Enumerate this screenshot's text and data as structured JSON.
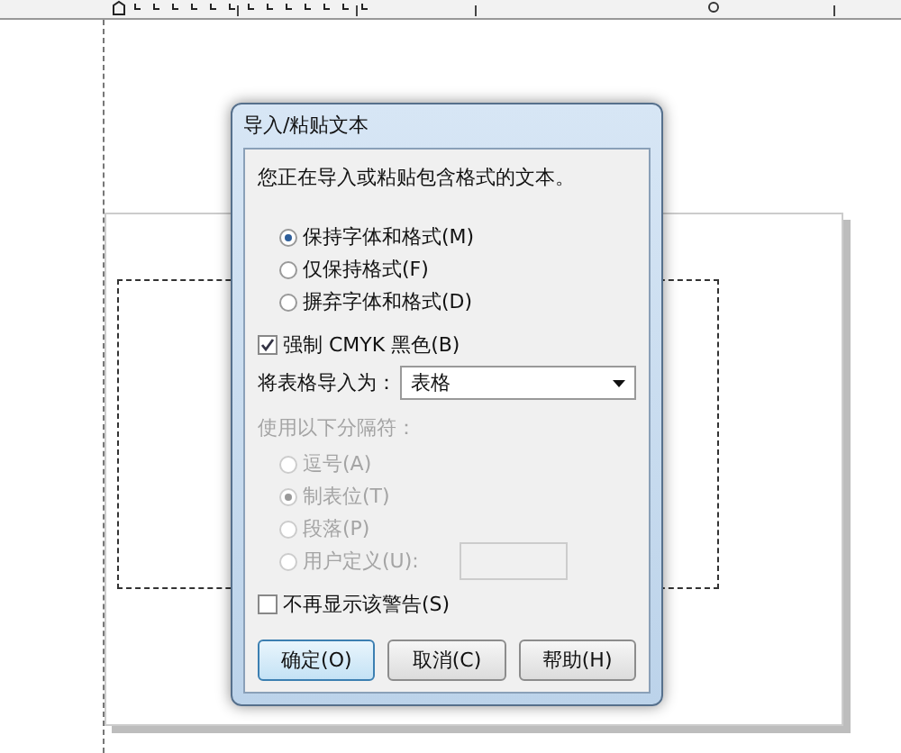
{
  "dialog": {
    "title": "导入/粘贴文本",
    "message": "您正在导入或粘贴包含格式的文本。",
    "format_options": [
      {
        "label": "保持字体和格式(M)",
        "selected": true
      },
      {
        "label": "仅保持格式(F)",
        "selected": false
      },
      {
        "label": "摒弃字体和格式(D)",
        "selected": false
      }
    ],
    "force_cmyk": {
      "label": "强制 CMYK 黑色(B)",
      "checked": true
    },
    "import_table": {
      "label": "将表格导入为：",
      "value": "表格"
    },
    "separators": {
      "label": "使用以下分隔符：",
      "disabled": true,
      "options": [
        {
          "label": "逗号(A)",
          "selected": false
        },
        {
          "label": "制表位(T)",
          "selected": true
        },
        {
          "label": "段落(P)",
          "selected": false
        },
        {
          "label": "用户定义(U):",
          "selected": false,
          "kind": "custom"
        }
      ]
    },
    "dont_show": {
      "label": "不再显示该警告(S)",
      "checked": false
    },
    "buttons": [
      {
        "label": "确定(O)",
        "default": true
      },
      {
        "label": "取消(C)",
        "default": false
      },
      {
        "label": "帮助(H)",
        "default": false
      }
    ]
  }
}
